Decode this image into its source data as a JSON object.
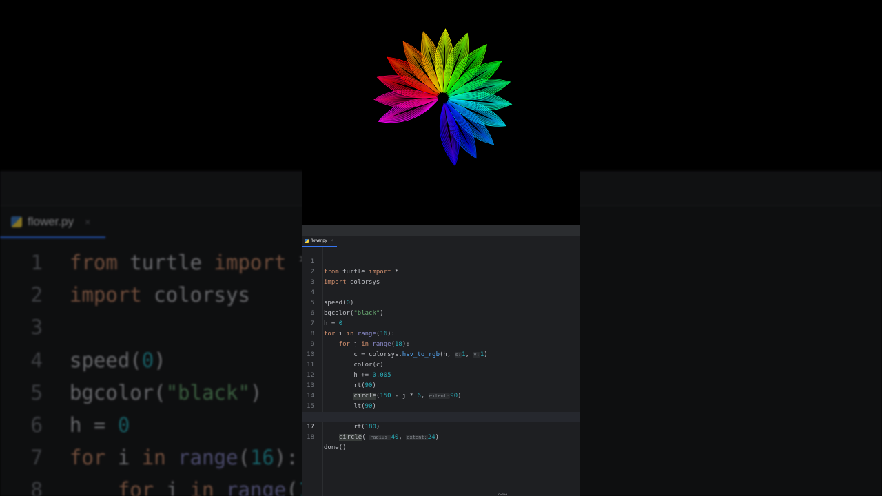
{
  "editor": {
    "tab_label": "flower.py",
    "tab_close": "×",
    "icon": "python-file-icon",
    "colors": {
      "background": "#1e1f22",
      "keyword": "#cf8e6d",
      "string": "#6aab73",
      "number": "#2aacb8",
      "accent": "#3574f0"
    }
  },
  "code_lines": [
    {
      "n": "1",
      "text": "from turtle import *"
    },
    {
      "n": "2",
      "text": "import colorsys"
    },
    {
      "n": "3",
      "text": ""
    },
    {
      "n": "4",
      "text": "speed(0)"
    },
    {
      "n": "5",
      "text": "bgcolor(\"black\")"
    },
    {
      "n": "6",
      "text": "h = 0"
    },
    {
      "n": "7",
      "text": "for i in range(16):"
    },
    {
      "n": "8",
      "text": "    for j in range(18):"
    },
    {
      "n": "9",
      "text": "        c = colorsys.hsv_to_rgb(h, s: 1, v: 1)"
    },
    {
      "n": "10",
      "text": "        color(c)"
    },
    {
      "n": "11",
      "text": "        h += 0.005"
    },
    {
      "n": "12",
      "text": "        rt(90)"
    },
    {
      "n": "13",
      "text": "        circle(150 - j * 6, extent: 90)"
    },
    {
      "n": "14",
      "text": "        lt(90)"
    },
    {
      "n": "15",
      "text": "        circle(150 - j * 6, extent: 90)"
    },
    {
      "n": "16",
      "text": "        rt(180)"
    },
    {
      "n": "17",
      "text": "    circle( radius: 40, extent: 24)"
    },
    {
      "n": "18",
      "text": "done()"
    }
  ],
  "hints": {
    "s": "s:",
    "v": "v:",
    "extent": "extent:",
    "radius": "radius:"
  },
  "bottom_badge": "CoPilot",
  "canvas": {
    "background": "#000000",
    "petals": 16
  }
}
